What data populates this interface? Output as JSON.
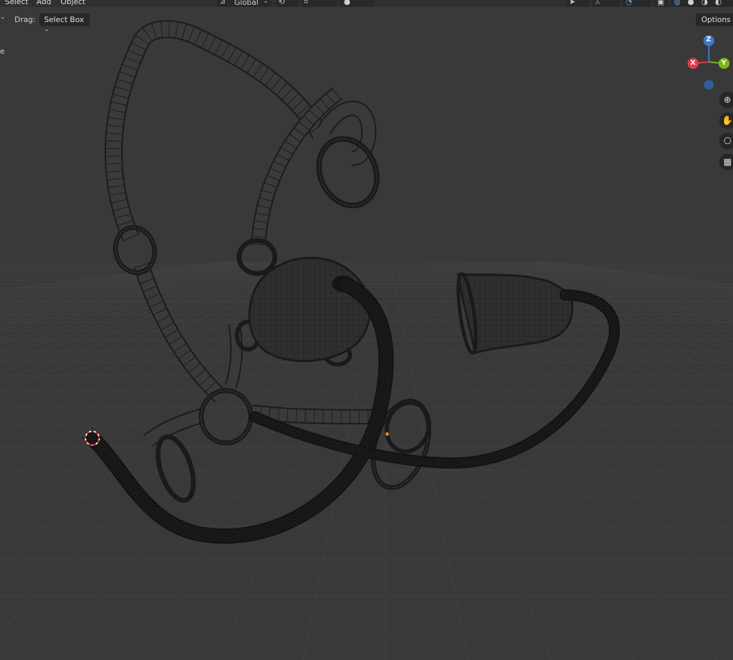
{
  "menubar": {
    "items": [
      "Select",
      "Add",
      "Object"
    ],
    "orientation": "Global"
  },
  "toolbar": {
    "drag_label": "Drag:",
    "drag_mode": "Select Box",
    "options_label": "Options"
  },
  "gizmo": {
    "z": "Z",
    "x": "X",
    "y": "Y"
  },
  "nav_icons": [
    "zoom-icon",
    "pan-hand-icon",
    "camera-icon",
    "grid-icon"
  ],
  "colors": {
    "background": "#393939",
    "grid": "#444444",
    "axis_x": "#e43b4f",
    "axis_y": "#7fb41a",
    "axis_z": "#3a78c9",
    "wire": "#1b1b1b",
    "tube": "#141414",
    "origin_dot": "#ff8c00"
  }
}
